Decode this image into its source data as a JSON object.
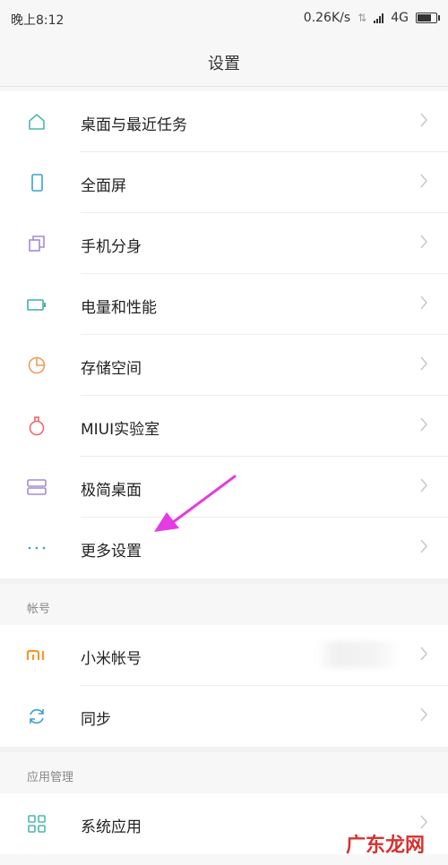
{
  "status_bar": {
    "time": "晚上8:12",
    "speed": "0.26K/s",
    "network": "4G"
  },
  "header": {
    "title": "设置"
  },
  "main_list": [
    {
      "label": "桌面与最近任务",
      "icon": "home-icon",
      "color": "#4fb6ad"
    },
    {
      "label": "全面屏",
      "icon": "phone-icon",
      "color": "#3a9fd8"
    },
    {
      "label": "手机分身",
      "icon": "clone-icon",
      "color": "#a48bd6"
    },
    {
      "label": "电量和性能",
      "icon": "battery-icon",
      "color": "#3fb0a6"
    },
    {
      "label": "存储空间",
      "icon": "pie-icon",
      "color": "#f09a5a"
    },
    {
      "label": "MIUI实验室",
      "icon": "flask-icon",
      "color": "#e86a6a"
    },
    {
      "label": "极简桌面",
      "icon": "layers-icon",
      "color": "#a48bd6"
    },
    {
      "label": "更多设置",
      "icon": "more-icon",
      "color": "#3a9fd8"
    }
  ],
  "account_section": {
    "title": "帐号",
    "items": [
      {
        "label": "小米帐号",
        "icon": "mi-logo-icon",
        "color": "#f29a2e"
      },
      {
        "label": "同步",
        "icon": "sync-icon",
        "color": "#3a9fd8"
      }
    ]
  },
  "apps_section": {
    "title": "应用管理",
    "items": [
      {
        "label": "系统应用",
        "icon": "grid-icon",
        "color": "#4fb6ad"
      }
    ]
  },
  "watermark": "广东龙网",
  "colors": {
    "arrow": "#e53be0",
    "chevron": "#c8c8c8"
  }
}
